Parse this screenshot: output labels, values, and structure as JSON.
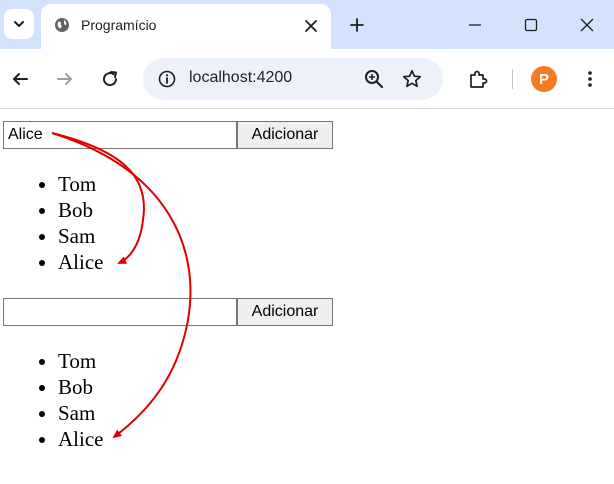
{
  "browser": {
    "tab_title": "Programício",
    "url": "localhost:4200",
    "profile_initial": "P"
  },
  "form1": {
    "input_value": "Alice",
    "button_label": "Adicionar",
    "items": [
      "Tom",
      "Bob",
      "Sam",
      "Alice"
    ]
  },
  "form2": {
    "input_value": "",
    "button_label": "Adicionar",
    "items": [
      "Tom",
      "Bob",
      "Sam",
      "Alice"
    ]
  },
  "annotation": {
    "arrow_color": "#e00000"
  }
}
